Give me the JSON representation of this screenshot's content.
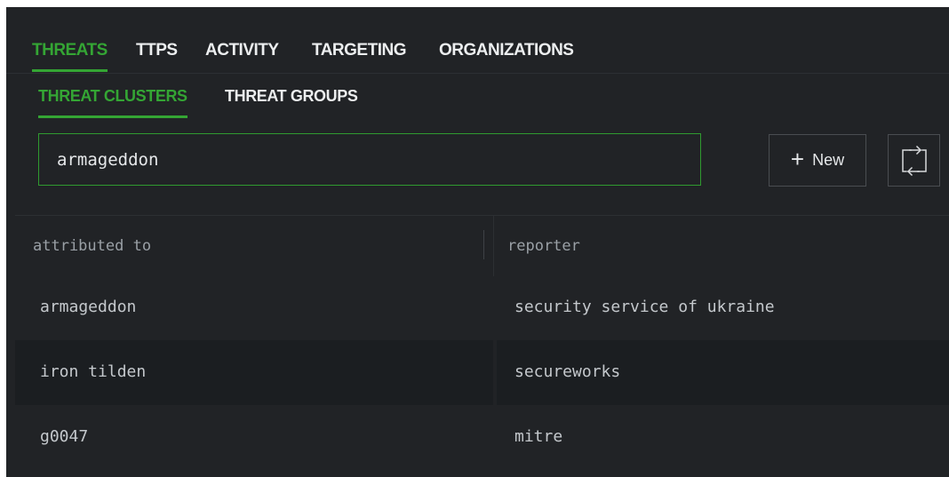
{
  "tabs": [
    {
      "label": "THREATS",
      "active": true
    },
    {
      "label": "TTPS",
      "active": false
    },
    {
      "label": "ACTIVITY",
      "active": false
    },
    {
      "label": "TARGETING",
      "active": false
    },
    {
      "label": "ORGANIZATIONS",
      "active": false
    }
  ],
  "subtabs": [
    {
      "label": "THREAT CLUSTERS",
      "active": true
    },
    {
      "label": "THREAT GROUPS",
      "active": false
    }
  ],
  "search": {
    "value": "armageddon"
  },
  "toolbar": {
    "new_icon": "plus-icon",
    "new_label": "New",
    "swap_icon": "swap-icon"
  },
  "table": {
    "columns": [
      "attributed to",
      "reporter"
    ],
    "rows": [
      {
        "attributed_to": "armageddon",
        "reporter": "security service of ukraine"
      },
      {
        "attributed_to": "iron tilden",
        "reporter": "secureworks"
      },
      {
        "attributed_to": "g0047",
        "reporter": "mitre"
      }
    ]
  },
  "colors": {
    "accent": "#34a534",
    "background": "#212326",
    "row_alt": "#1b1e21",
    "text": "#eceeef"
  }
}
